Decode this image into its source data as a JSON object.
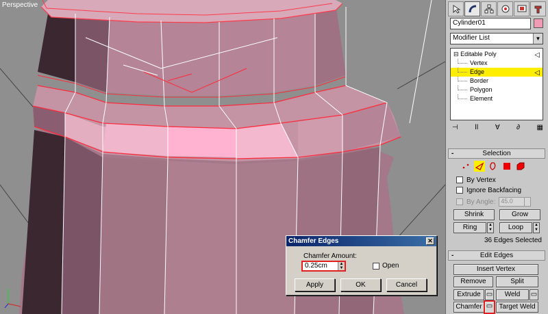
{
  "viewport": {
    "label": "Perspective"
  },
  "command_panel": {
    "tabs": [
      {
        "name": "create-tab",
        "icon": "pointer-icon"
      },
      {
        "name": "modify-tab",
        "icon": "bend-icon"
      },
      {
        "name": "hierarchy-tab",
        "icon": "hierarchy-icon"
      },
      {
        "name": "motion-tab",
        "icon": "motion-icon"
      },
      {
        "name": "display-tab",
        "icon": "display-icon"
      },
      {
        "name": "utilities-tab",
        "icon": "hammer-icon"
      }
    ],
    "object_name": "Cylinder01",
    "object_color": "#f09cb4",
    "modifier_list_label": "Modifier List",
    "stack": {
      "root": "Editable Poly",
      "items": [
        "Vertex",
        "Edge",
        "Border",
        "Polygon",
        "Element"
      ],
      "selected": "Edge"
    },
    "selection_rollout": {
      "title": "Selection",
      "by_vertex": "By Vertex",
      "ignore_backfacing": "Ignore Backfacing",
      "by_angle": "By Angle:",
      "angle_value": "45.0",
      "shrink": "Shrink",
      "grow": "Grow",
      "ring": "Ring",
      "loop": "Loop",
      "status": "36 Edges Selected"
    },
    "edit_edges_rollout": {
      "title": "Edit Edges",
      "insert_vertex": "Insert Vertex",
      "remove": "Remove",
      "split": "Split",
      "extrude": "Extrude",
      "weld": "Weld",
      "chamfer": "Chamfer",
      "target_weld": "Target Weld"
    }
  },
  "dialog": {
    "title": "Chamfer Edges",
    "amount_label": "Chamfer Amount:",
    "amount_value": "0.25cm",
    "open_label": "Open",
    "apply": "Apply",
    "ok": "OK",
    "cancel": "Cancel"
  },
  "colors": {
    "highlight": "#e02020",
    "selected_stack": "#ffee00",
    "mesh": "#b58597"
  }
}
